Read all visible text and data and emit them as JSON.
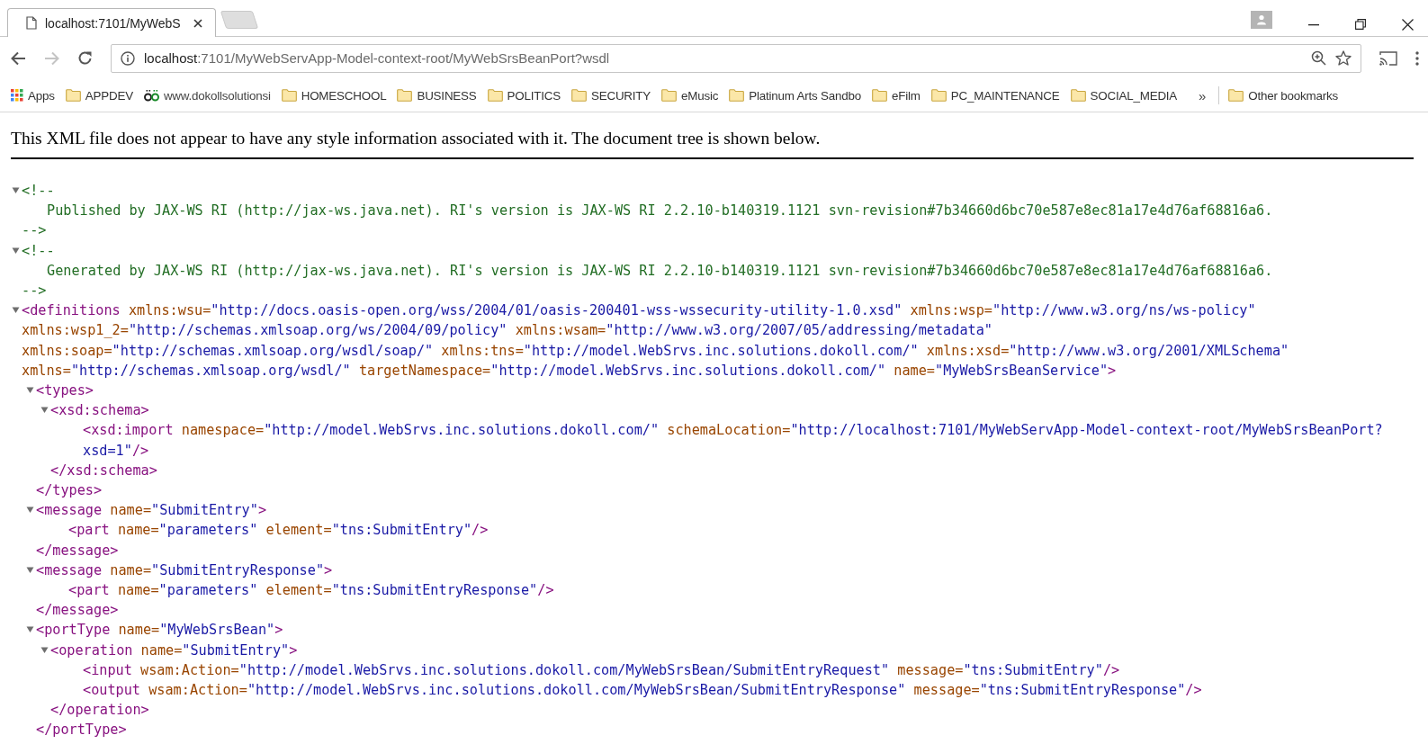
{
  "tab": {
    "title": "localhost:7101/MyWebS",
    "selected": true
  },
  "address_bar": {
    "host": "localhost",
    "path": ":7101/MyWebServApp-Model-context-root/MyWebSrsBeanPort?wsdl"
  },
  "bookmarks": [
    {
      "kind": "apps",
      "label": "Apps"
    },
    {
      "kind": "folder",
      "label": "APPDEV"
    },
    {
      "kind": "site",
      "label": "www.dokollsolutionsi"
    },
    {
      "kind": "folder",
      "label": "HOMESCHOOL"
    },
    {
      "kind": "folder",
      "label": "BUSINESS"
    },
    {
      "kind": "folder",
      "label": "POLITICS"
    },
    {
      "kind": "folder",
      "label": "SECURITY"
    },
    {
      "kind": "folder",
      "label": "eMusic"
    },
    {
      "kind": "folder",
      "label": "Platinum Arts Sandbo"
    },
    {
      "kind": "folder",
      "label": "eFilm"
    },
    {
      "kind": "folder",
      "label": "PC_MAINTENANCE"
    },
    {
      "kind": "folder",
      "label": "SOCIAL_MEDIA"
    }
  ],
  "bookmarks_overflow": "»",
  "other_bookmarks": "Other bookmarks",
  "notice": "This XML file does not appear to have any style information associated with it. The document tree is shown below.",
  "tree": [
    {
      "kind": "comment",
      "expanded": true,
      "open": "<!--",
      "body": "Published by JAX-WS RI (http://jax-ws.java.net). RI's version is JAX-WS RI 2.2.10-b140319.1121 svn-revision#7b34660d6bc70e587e8ec81a17e4d76af68816a6.",
      "close": "-->"
    },
    {
      "kind": "comment",
      "expanded": true,
      "open": "<!--",
      "body": "Generated by JAX-WS RI (http://jax-ws.java.net). RI's version is JAX-WS RI 2.2.10-b140319.1121 svn-revision#7b34660d6bc70e587e8ec81a17e4d76af68816a6.",
      "close": "-->"
    },
    {
      "kind": "element",
      "expanded": true,
      "lines": [
        [
          {
            "kind": "tag",
            "s": "<definitions"
          },
          {
            "kind": "attr",
            "s": "xmlns:wsu="
          },
          {
            "kind": "val",
            "s": "\"http://docs.oasis-open.org/wss/2004/01/oasis-200401-wss-wssecurity-utility-1.0.xsd\""
          },
          {
            "kind": "attr",
            "s": "xmlns:wsp="
          },
          {
            "kind": "val",
            "s": "\"http://www.w3.org/ns/ws-policy\""
          }
        ],
        [
          {
            "kind": "attr",
            "s": "xmlns:wsp1_2="
          },
          {
            "kind": "val",
            "s": "\"http://schemas.xmlsoap.org/ws/2004/09/policy\""
          },
          {
            "kind": "attr",
            "s": "xmlns:wsam="
          },
          {
            "kind": "val",
            "s": "\"http://www.w3.org/2007/05/addressing/metadata\""
          }
        ],
        [
          {
            "kind": "attr",
            "s": "xmlns:soap="
          },
          {
            "kind": "val",
            "s": "\"http://schemas.xmlsoap.org/wsdl/soap/\""
          },
          {
            "kind": "attr",
            "s": "xmlns:tns="
          },
          {
            "kind": "val",
            "s": "\"http://model.WebSrvs.inc.solutions.dokoll.com/\""
          },
          {
            "kind": "attr",
            "s": "xmlns:xsd="
          },
          {
            "kind": "val",
            "s": "\"http://www.w3.org/2001/XMLSchema\""
          }
        ],
        [
          {
            "kind": "attr",
            "s": "xmlns="
          },
          {
            "kind": "val",
            "s": "\"http://schemas.xmlsoap.org/wsdl/\""
          },
          {
            "kind": "attr",
            "s": "targetNamespace="
          },
          {
            "kind": "val",
            "s": "\"http://model.WebSrvs.inc.solutions.dokoll.com/\""
          },
          {
            "kind": "attr",
            "s": "name="
          },
          {
            "kind": "val",
            "s": "\"MyWebSrsBeanService\""
          },
          {
            "kind": "tag",
            "s": ">"
          }
        ]
      ],
      "children": [
        {
          "kind": "element",
          "expanded": true,
          "lines": [
            [
              {
                "kind": "tag",
                "s": "<types>"
              }
            ]
          ],
          "children": [
            {
              "kind": "element",
              "expanded": true,
              "lines": [
                [
                  {
                    "kind": "tag",
                    "s": "<xsd:schema>"
                  }
                ]
              ],
              "children": [
                {
                  "kind": "leaf",
                  "lines": [
                    [
                      {
                        "kind": "tag",
                        "s": "<xsd:import"
                      },
                      {
                        "kind": "attr",
                        "s": "namespace="
                      },
                      {
                        "kind": "val",
                        "s": "\"http://model.WebSrvs.inc.solutions.dokoll.com/\""
                      },
                      {
                        "kind": "attr",
                        "s": "schemaLocation="
                      },
                      {
                        "kind": "val",
                        "s": "\"http://localhost:7101/MyWebServApp-Model-context-root/MyWebSrsBeanPort?"
                      }
                    ],
                    [
                      {
                        "kind": "val",
                        "s": "xsd=1\""
                      },
                      {
                        "kind": "tag",
                        "s": "/>"
                      }
                    ]
                  ]
                }
              ],
              "close": [
                {
                  "kind": "tag",
                  "s": "</xsd:schema>"
                }
              ]
            }
          ],
          "close": [
            {
              "kind": "tag",
              "s": "</types>"
            }
          ]
        },
        {
          "kind": "element",
          "expanded": true,
          "lines": [
            [
              {
                "kind": "tag",
                "s": "<message"
              },
              {
                "kind": "attr",
                "s": "name="
              },
              {
                "kind": "val",
                "s": "\"SubmitEntry\""
              },
              {
                "kind": "tag",
                "s": ">"
              }
            ]
          ],
          "children": [
            {
              "kind": "leaf",
              "lines": [
                [
                  {
                    "kind": "tag",
                    "s": "<part"
                  },
                  {
                    "kind": "attr",
                    "s": "name="
                  },
                  {
                    "kind": "val",
                    "s": "\"parameters\""
                  },
                  {
                    "kind": "attr",
                    "s": "element="
                  },
                  {
                    "kind": "val",
                    "s": "\"tns:SubmitEntry\""
                  },
                  {
                    "kind": "tag",
                    "s": "/>"
                  }
                ]
              ]
            }
          ],
          "close": [
            {
              "kind": "tag",
              "s": "</message>"
            }
          ]
        },
        {
          "kind": "element",
          "expanded": true,
          "lines": [
            [
              {
                "kind": "tag",
                "s": "<message"
              },
              {
                "kind": "attr",
                "s": "name="
              },
              {
                "kind": "val",
                "s": "\"SubmitEntryResponse\""
              },
              {
                "kind": "tag",
                "s": ">"
              }
            ]
          ],
          "children": [
            {
              "kind": "leaf",
              "lines": [
                [
                  {
                    "kind": "tag",
                    "s": "<part"
                  },
                  {
                    "kind": "attr",
                    "s": "name="
                  },
                  {
                    "kind": "val",
                    "s": "\"parameters\""
                  },
                  {
                    "kind": "attr",
                    "s": "element="
                  },
                  {
                    "kind": "val",
                    "s": "\"tns:SubmitEntryResponse\""
                  },
                  {
                    "kind": "tag",
                    "s": "/>"
                  }
                ]
              ]
            }
          ],
          "close": [
            {
              "kind": "tag",
              "s": "</message>"
            }
          ]
        },
        {
          "kind": "element",
          "expanded": true,
          "lines": [
            [
              {
                "kind": "tag",
                "s": "<portType"
              },
              {
                "kind": "attr",
                "s": "name="
              },
              {
                "kind": "val",
                "s": "\"MyWebSrsBean\""
              },
              {
                "kind": "tag",
                "s": ">"
              }
            ]
          ],
          "children": [
            {
              "kind": "element",
              "expanded": true,
              "lines": [
                [
                  {
                    "kind": "tag",
                    "s": "<operation"
                  },
                  {
                    "kind": "attr",
                    "s": "name="
                  },
                  {
                    "kind": "val",
                    "s": "\"SubmitEntry\""
                  },
                  {
                    "kind": "tag",
                    "s": ">"
                  }
                ]
              ],
              "children": [
                {
                  "kind": "leaf",
                  "lines": [
                    [
                      {
                        "kind": "tag",
                        "s": "<input"
                      },
                      {
                        "kind": "attr",
                        "s": "wsam:Action="
                      },
                      {
                        "kind": "val",
                        "s": "\"http://model.WebSrvs.inc.solutions.dokoll.com/MyWebSrsBean/SubmitEntryRequest\""
                      },
                      {
                        "kind": "attr",
                        "s": "message="
                      },
                      {
                        "kind": "val",
                        "s": "\"tns:SubmitEntry\""
                      },
                      {
                        "kind": "tag",
                        "s": "/>"
                      }
                    ]
                  ]
                },
                {
                  "kind": "leaf",
                  "lines": [
                    [
                      {
                        "kind": "tag",
                        "s": "<output"
                      },
                      {
                        "kind": "attr",
                        "s": "wsam:Action="
                      },
                      {
                        "kind": "val",
                        "s": "\"http://model.WebSrvs.inc.solutions.dokoll.com/MyWebSrsBean/SubmitEntryResponse\""
                      },
                      {
                        "kind": "attr",
                        "s": "message="
                      },
                      {
                        "kind": "val",
                        "s": "\"tns:SubmitEntryResponse\""
                      },
                      {
                        "kind": "tag",
                        "s": "/>"
                      }
                    ]
                  ]
                }
              ],
              "close": [
                {
                  "kind": "tag",
                  "s": "</operation>"
                }
              ]
            }
          ],
          "close": [
            {
              "kind": "tag",
              "s": "</portType>"
            }
          ]
        }
      ]
    }
  ]
}
